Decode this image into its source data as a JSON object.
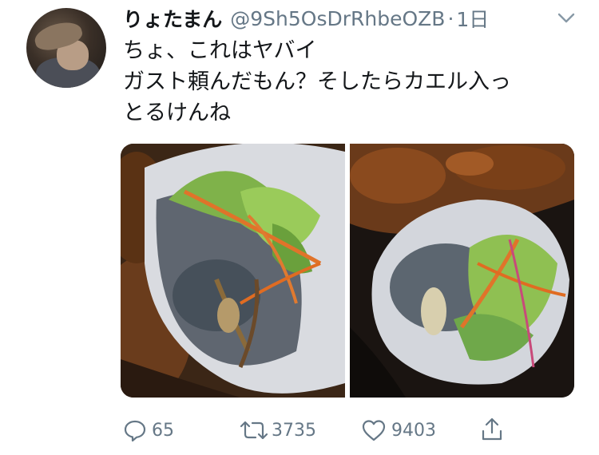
{
  "tweet": {
    "display_name": "りょたまん",
    "handle": "@9Sh5OsDrRhbeOZB",
    "separator": "·",
    "time": "1日",
    "text_lines": [
      "ちょ、これはヤバイ",
      "ガスト頼んだもん？そしたらカエル入っ",
      "とるけんね"
    ]
  },
  "actions": {
    "reply_count": "65",
    "retweet_count": "3735",
    "like_count": "9403"
  },
  "colors": {
    "text": "#14171a",
    "secondary": "#657786"
  }
}
